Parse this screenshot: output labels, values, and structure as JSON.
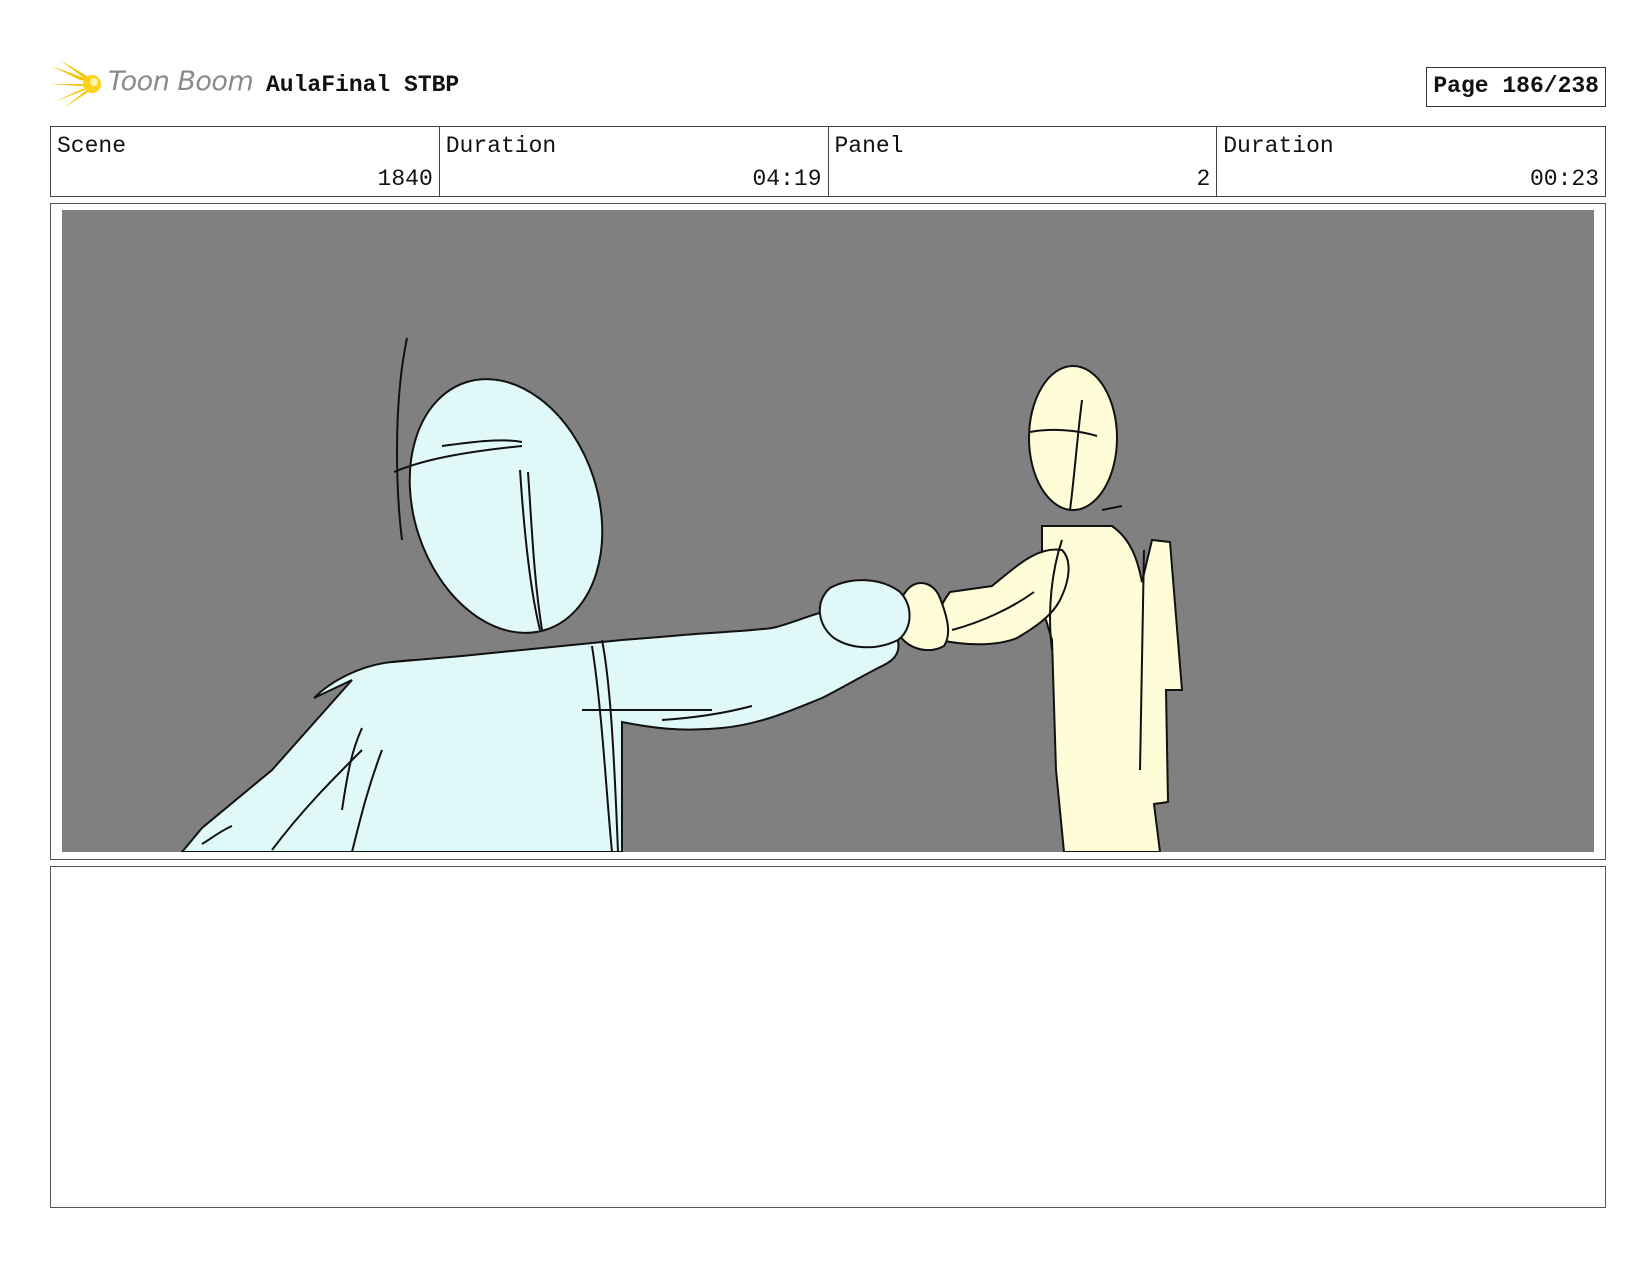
{
  "header": {
    "logo_text": "Toon Boom",
    "project_title": "AulaFinal STBP",
    "page_label": "Page 186/238"
  },
  "info": {
    "scene_label": "Scene",
    "scene_value": "1840",
    "scene_duration_label": "Duration",
    "scene_duration_value": "04:19",
    "panel_label": "Panel",
    "panel_value": "2",
    "panel_duration_label": "Duration",
    "panel_duration_value": "00:23"
  },
  "panel": {
    "background_color": "#808080",
    "character_left_color": "#e0f8f8",
    "character_right_color": "#fffcd8"
  },
  "notes": {
    "text": ""
  },
  "colors": {
    "logo_accent": "#f5c400",
    "logo_text": "#8a8a8a"
  }
}
